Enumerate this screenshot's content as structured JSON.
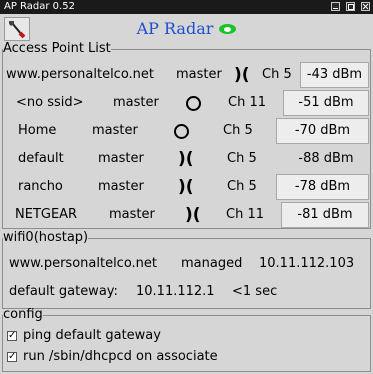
{
  "window": {
    "title": "AP Radar 0.52"
  },
  "header": {
    "title": "AP Radar"
  },
  "ap_list": {
    "legend": "Access Point List",
    "rows": [
      {
        "ssid": "www.personaltelco.net",
        "mode": "master",
        "icon": "adhoc-icon",
        "channel": "Ch 5",
        "signal": "-43 dBm"
      },
      {
        "ssid": "<no ssid>",
        "mode": "master",
        "icon": "circle-icon",
        "channel": "Ch 11",
        "signal": "-51 dBm"
      },
      {
        "ssid": "Home",
        "mode": "master",
        "icon": "circle-icon",
        "channel": "Ch 5",
        "signal": "-70 dBm"
      },
      {
        "ssid": "default",
        "mode": "master",
        "icon": "adhoc-icon",
        "channel": "Ch 5",
        "signal": "-88 dBm"
      },
      {
        "ssid": "rancho",
        "mode": "master",
        "icon": "adhoc-icon",
        "channel": "Ch 5",
        "signal": "-78 dBm"
      },
      {
        "ssid": "NETGEAR",
        "mode": "master",
        "icon": "adhoc-icon",
        "channel": "Ch 11",
        "signal": "-81 dBm"
      }
    ]
  },
  "iface": {
    "legend": "wifi0(hostap)",
    "ssid": "www.personaltelco.net",
    "status": "managed",
    "ip": "10.11.112.103",
    "gateway_label": "default gateway:",
    "gateway_ip": "10.11.112.1",
    "latency": "<1 sec"
  },
  "config": {
    "legend": "config",
    "options": [
      {
        "label": "ping default gateway",
        "checked": true
      },
      {
        "label": "run /sbin/dhcpcd on associate",
        "checked": true
      }
    ]
  }
}
